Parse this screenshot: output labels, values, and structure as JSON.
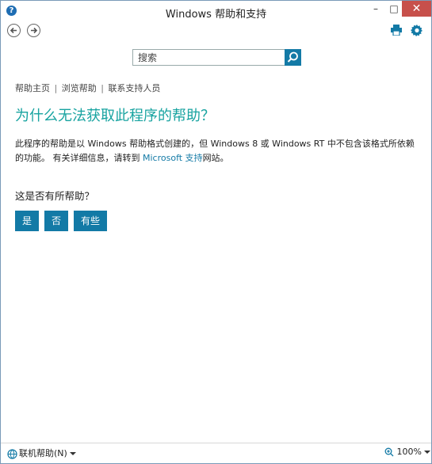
{
  "window": {
    "title": "Windows 帮助和支持",
    "minimize": "–",
    "maximize": "□",
    "close": "✕"
  },
  "search": {
    "placeholder": "搜索"
  },
  "breadcrumb": {
    "home": "帮助主页",
    "browse": "浏览帮助",
    "contact": "联系支持人员",
    "sep": "|"
  },
  "article": {
    "title": "为什么无法获取此程序的帮助？",
    "body_part1": "此程序的帮助是以 Windows 帮助格式创建的，但 Windows 8 或 Windows RT 中不包含该格式所依赖的功能。 有关详细信息，请转到 ",
    "link": "Microsoft 支持",
    "body_part2": "网站。"
  },
  "feedback": {
    "question": "这是否有所帮助？",
    "yes": "是",
    "no": "否",
    "some": "有些"
  },
  "statusbar": {
    "online": "联机帮助(N)",
    "zoom": "100%"
  },
  "colors": {
    "accent": "#137aa6",
    "title": "#17a3a0",
    "close": "#c7504b"
  }
}
